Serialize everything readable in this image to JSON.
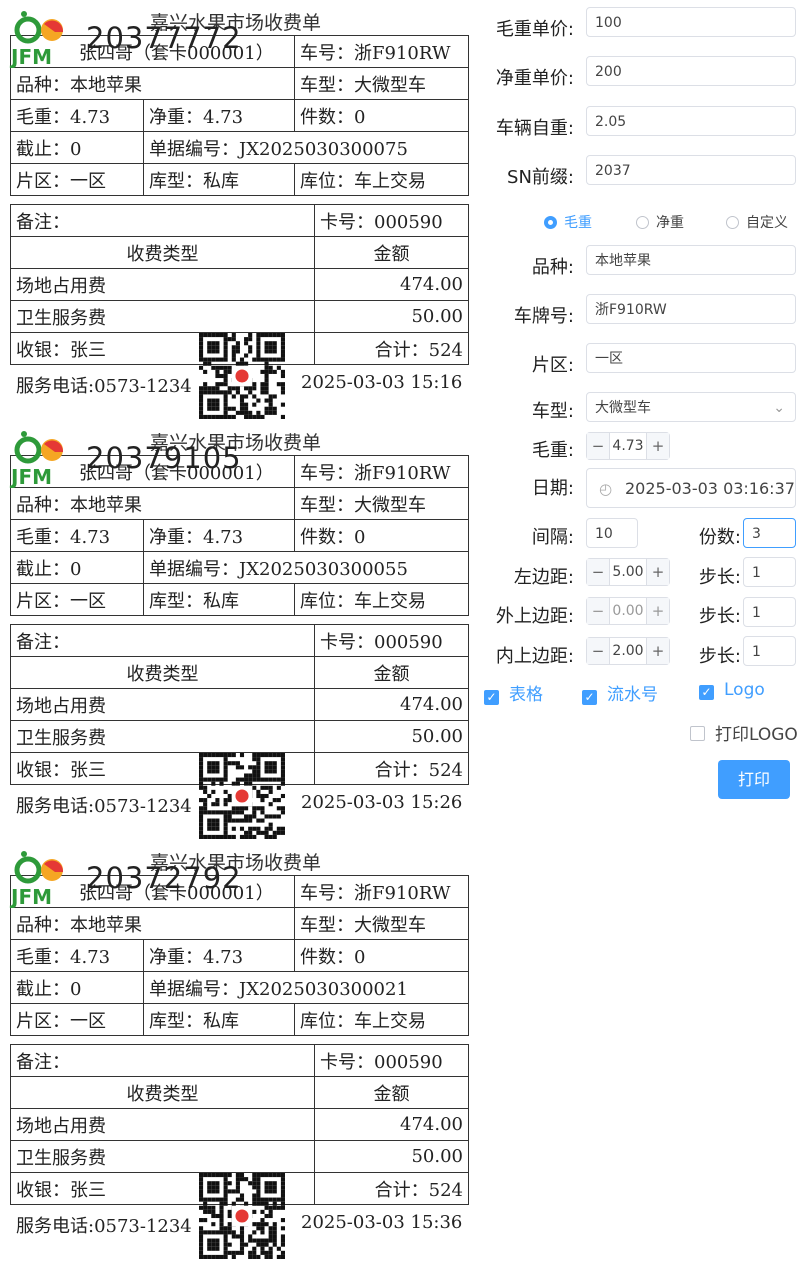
{
  "receipts": [
    {
      "title": "嘉兴水果市场收费单",
      "serial": "20377772",
      "owner": "张四哥（套卡000001）",
      "plate": "车号：浙F910RW",
      "variety": "品种：本地苹果",
      "vehicle_type": "车型：大微型车",
      "gross": "毛重：4.73",
      "net": "净重：4.73",
      "pieces": "件数：0",
      "cutoff": "截止：0",
      "bill_no": "单据编号：JX2025030300075",
      "zone": "片区：一区",
      "storage": "库型：私库",
      "position": "库位：车上交易",
      "remark": "备注：",
      "card": "卡号：000590",
      "fee_type_header": "收费类型",
      "amount_header": "金额",
      "fee1_name": "场地占用费",
      "fee1_amount": "474.00",
      "fee2_name": "卫生服务费",
      "fee2_amount": "50.00",
      "cashier": "收银：张三",
      "total": "合计：524",
      "phone": "服务电话:0573-1234",
      "datetime": "2025-03-03 15:16"
    },
    {
      "title": "嘉兴水果市场收费单",
      "serial": "20379105",
      "owner": "张四哥（套卡000001）",
      "plate": "车号：浙F910RW",
      "variety": "品种：本地苹果",
      "vehicle_type": "车型：大微型车",
      "gross": "毛重：4.73",
      "net": "净重：4.73",
      "pieces": "件数：0",
      "cutoff": "截止：0",
      "bill_no": "单据编号：JX2025030300055",
      "zone": "片区：一区",
      "storage": "库型：私库",
      "position": "库位：车上交易",
      "remark": "备注：",
      "card": "卡号：000590",
      "fee_type_header": "收费类型",
      "amount_header": "金额",
      "fee1_name": "场地占用费",
      "fee1_amount": "474.00",
      "fee2_name": "卫生服务费",
      "fee2_amount": "50.00",
      "cashier": "收银：张三",
      "total": "合计：524",
      "phone": "服务电话:0573-1234",
      "datetime": "2025-03-03 15:26"
    },
    {
      "title": "嘉兴水果市场收费单",
      "serial": "20372792",
      "owner": "张四哥（套卡000001）",
      "plate": "车号：浙F910RW",
      "variety": "品种：本地苹果",
      "vehicle_type": "车型：大微型车",
      "gross": "毛重：4.73",
      "net": "净重：4.73",
      "pieces": "件数：0",
      "cutoff": "截止：0",
      "bill_no": "单据编号：JX2025030300021",
      "zone": "片区：一区",
      "storage": "库型：私库",
      "position": "库位：车上交易",
      "remark": "备注：",
      "card": "卡号：000590",
      "fee_type_header": "收费类型",
      "amount_header": "金额",
      "fee1_name": "场地占用费",
      "fee1_amount": "474.00",
      "fee2_name": "卫生服务费",
      "fee2_amount": "50.00",
      "cashier": "收银：张三",
      "total": "合计：524",
      "phone": "服务电话:0573-1234",
      "datetime": "2025-03-03 15:36"
    }
  ],
  "logo_text": "JFM",
  "panel": {
    "gross_price_label": "毛重单价:",
    "gross_price": "100",
    "net_price_label": "净重单价:",
    "net_price": "200",
    "tare_label": "车辆自重:",
    "tare": "2.05",
    "sn_prefix_label": "SN前缀:",
    "sn_prefix": "2037",
    "radio_gross": "毛重",
    "radio_net": "净重",
    "radio_custom": "自定义",
    "selected_radio": "毛重",
    "variety_label": "品种:",
    "variety": "本地苹果",
    "plate_label": "车牌号:",
    "plate": "浙F910RW",
    "zone_label": "片区:",
    "zone": "一区",
    "vtype_label": "车型:",
    "vtype": "大微型车",
    "weight_label": "毛重:",
    "weight": "4.73",
    "date_label": "日期:",
    "date": "2025-03-03 03:16:37",
    "interval_label": "间隔:",
    "interval": "10",
    "copies_label": "份数:",
    "copies": "3",
    "left_margin_label": "左边距:",
    "left_margin": "5.00",
    "step_label": "步长:",
    "left_step": "1",
    "outer_top_label": "外上边距:",
    "outer_top": "0.00",
    "outer_step": "1",
    "inner_top_label": "内上边距:",
    "inner_top": "2.00",
    "inner_step": "1",
    "chk_table": "表格",
    "chk_serial": "流水号",
    "chk_logo": "Logo",
    "chk_print_logo": "打印LOGO",
    "print": "打印"
  },
  "colors": {
    "accent": "#409eff",
    "logo_green": "#2e9a3a",
    "logo_orange": "#f5a623",
    "logo_red": "#e53935"
  }
}
